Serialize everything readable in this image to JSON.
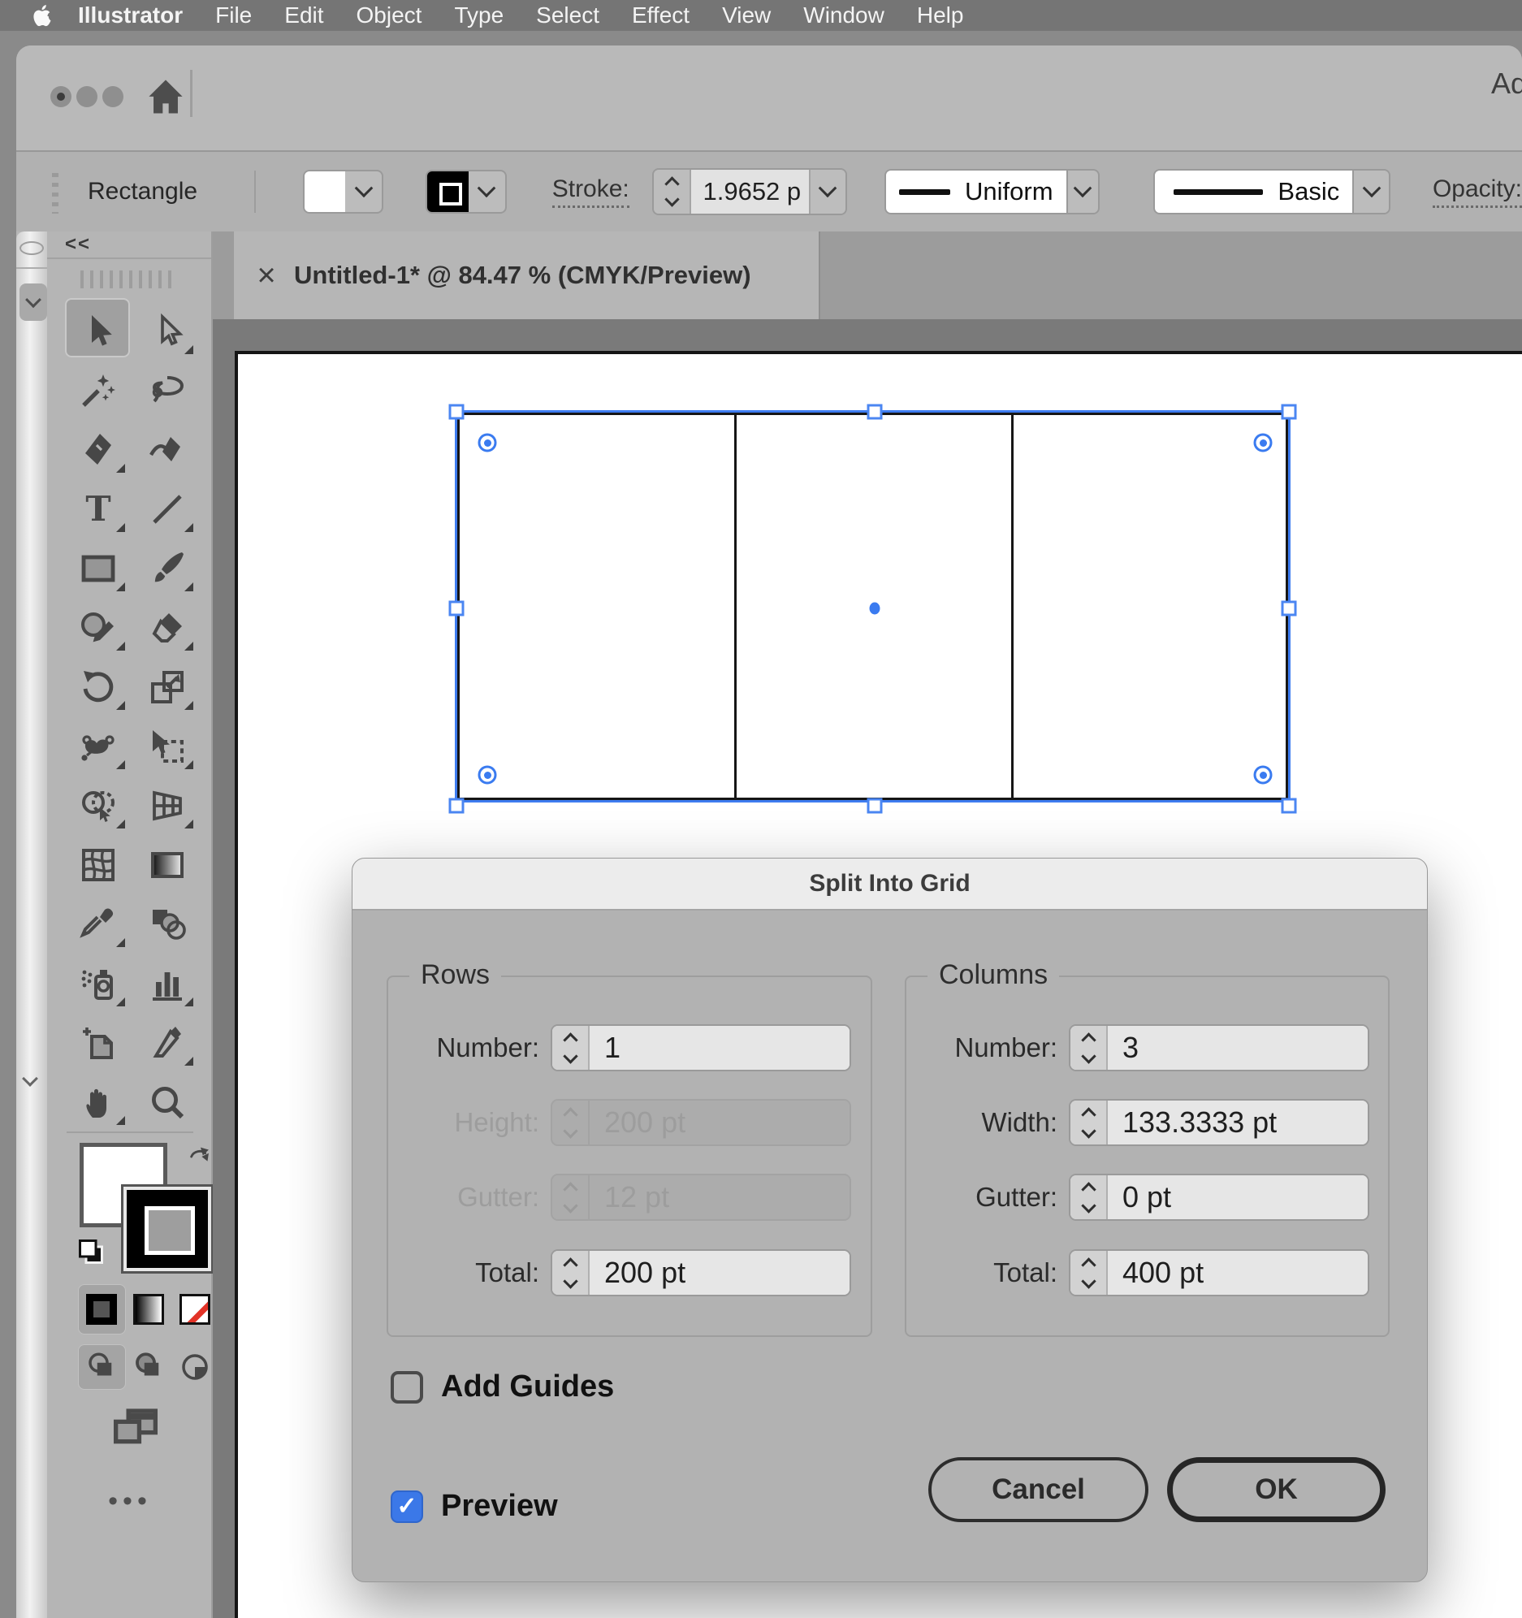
{
  "menubar": {
    "apple_icon": "apple-logo",
    "app_name": "Illustrator",
    "items": [
      "File",
      "Edit",
      "Object",
      "Type",
      "Select",
      "Effect",
      "View",
      "Window",
      "Help"
    ]
  },
  "window_header": {
    "home_icon": "home",
    "clipped_right_text": "Ad"
  },
  "control_bar": {
    "selected_object_label": "Rectangle",
    "fill_swatch": "white",
    "stroke_swatch": "black",
    "stroke_label": "Stroke:",
    "stroke_weight": "1.9652 p",
    "variable_width_profile": "Uniform",
    "brush_definition": "Basic",
    "opacity_label": "Opacity:"
  },
  "document_tab": {
    "close_glyph": "×",
    "title": "Untitled-1* @ 84.47 % (CMYK/Preview)"
  },
  "tools_panel": {
    "collapse_glyph": "<<",
    "tools": [
      {
        "name": "selection",
        "active": true,
        "flyout": false
      },
      {
        "name": "direct-selection",
        "active": false,
        "flyout": true
      },
      {
        "name": "magic-wand",
        "active": false,
        "flyout": false
      },
      {
        "name": "lasso",
        "active": false,
        "flyout": false
      },
      {
        "name": "pen",
        "active": false,
        "flyout": true
      },
      {
        "name": "curvature-pen",
        "active": false,
        "flyout": false
      },
      {
        "name": "type",
        "active": false,
        "flyout": true
      },
      {
        "name": "line-segment",
        "active": false,
        "flyout": true
      },
      {
        "name": "rectangle",
        "active": false,
        "flyout": true
      },
      {
        "name": "paintbrush",
        "active": false,
        "flyout": true
      },
      {
        "name": "shaper",
        "active": false,
        "flyout": true
      },
      {
        "name": "eraser",
        "active": false,
        "flyout": true
      },
      {
        "name": "rotate",
        "active": false,
        "flyout": true
      },
      {
        "name": "scale",
        "active": false,
        "flyout": true
      },
      {
        "name": "width",
        "active": false,
        "flyout": true
      },
      {
        "name": "free-transform",
        "active": false,
        "flyout": true
      },
      {
        "name": "shape-builder",
        "active": false,
        "flyout": true
      },
      {
        "name": "perspective-grid",
        "active": false,
        "flyout": true
      },
      {
        "name": "mesh",
        "active": false,
        "flyout": false
      },
      {
        "name": "gradient",
        "active": false,
        "flyout": false
      },
      {
        "name": "eyedropper",
        "active": false,
        "flyout": true
      },
      {
        "name": "blend",
        "active": false,
        "flyout": false
      },
      {
        "name": "symbol-sprayer",
        "active": false,
        "flyout": true
      },
      {
        "name": "column-graph",
        "active": false,
        "flyout": true
      },
      {
        "name": "artboard",
        "active": false,
        "flyout": false
      },
      {
        "name": "slice",
        "active": false,
        "flyout": true
      },
      {
        "name": "hand",
        "active": false,
        "flyout": true
      },
      {
        "name": "zoom",
        "active": false,
        "flyout": false
      }
    ],
    "ellipsis": "•••"
  },
  "canvas": {
    "grid_rows": 1,
    "grid_columns": 3
  },
  "dialog": {
    "title": "Split Into Grid",
    "rows_group": {
      "legend": "Rows",
      "fields": [
        {
          "label": "Number:",
          "value": "1",
          "disabled": false
        },
        {
          "label": "Height:",
          "value": "200 pt",
          "disabled": true
        },
        {
          "label": "Gutter:",
          "value": "12 pt",
          "disabled": true
        },
        {
          "label": "Total:",
          "value": "200 pt",
          "disabled": false
        }
      ]
    },
    "columns_group": {
      "legend": "Columns",
      "fields": [
        {
          "label": "Number:",
          "value": "3",
          "disabled": false
        },
        {
          "label": "Width:",
          "value": "133.3333 pt",
          "disabled": false
        },
        {
          "label": "Gutter:",
          "value": "0 pt",
          "disabled": false
        },
        {
          "label": "Total:",
          "value": "400 pt",
          "disabled": false
        }
      ]
    },
    "add_guides": {
      "label": "Add Guides",
      "checked": false
    },
    "preview": {
      "label": "Preview",
      "checked": true,
      "check_glyph": "✓"
    },
    "cancel_label": "Cancel",
    "ok_label": "OK"
  },
  "colors": {
    "selection_blue": "#3a7bf0",
    "checkbox_blue": "#3b78e8",
    "none_swatch_red": "#e23327",
    "menubar_gray": "#757575",
    "panel_gray": "#b2b2b2",
    "pasteboard_gray": "#7a7a7a"
  }
}
